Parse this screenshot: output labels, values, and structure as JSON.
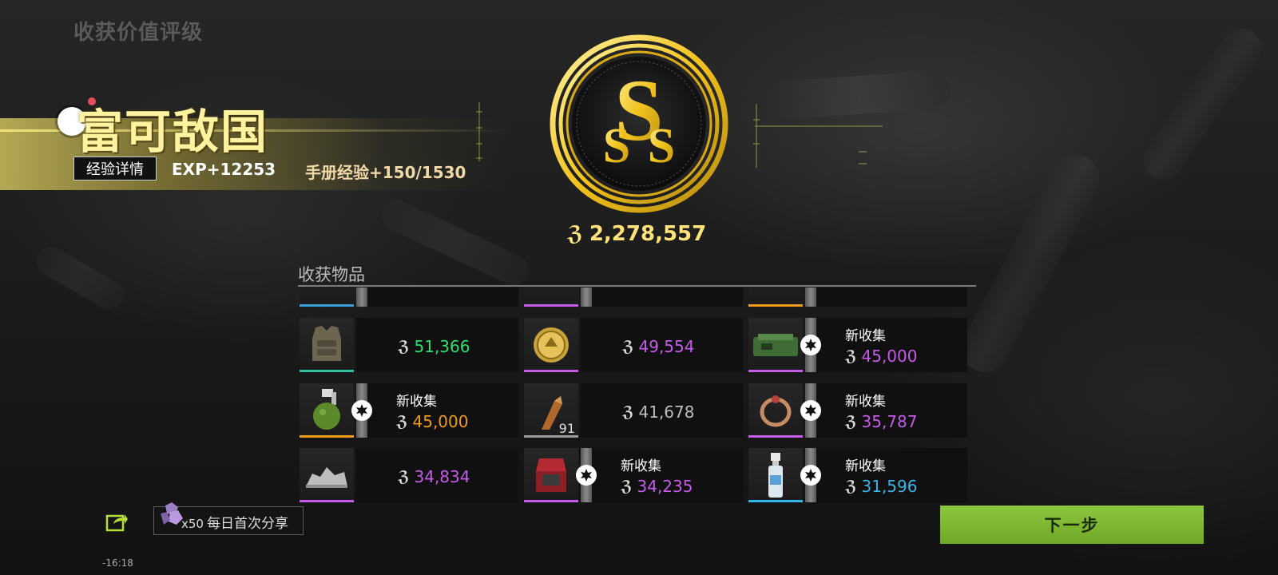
{
  "page": {
    "title": "收获价值评级"
  },
  "rank": {
    "title": "富可敌国",
    "exp_detail_label": "经验详情",
    "exp": "EXP+12253",
    "manual_exp": "手册经验+150/1530",
    "grade": "SSS",
    "total_value": "2,278,557",
    "total_value_color": "#ffe37a"
  },
  "items": {
    "header": "收获物品",
    "new_label_text": "新收集",
    "rows": [
      [
        {
          "name": "body-armor",
          "value": "51,366",
          "color": "#2ee06f",
          "rarity": "#2fbf9a",
          "new": false,
          "count": ""
        },
        {
          "name": "gold-coin",
          "value": "49,554",
          "color": "#c65bea",
          "rarity": "#c65bea",
          "new": false,
          "count": ""
        },
        {
          "name": "green-device",
          "value": "45,000",
          "color": "#c65bea",
          "rarity": "#c65bea",
          "new": true,
          "count": ""
        }
      ],
      [
        {
          "name": "grenade",
          "value": "45,000",
          "color": "#f09a19",
          "rarity": "#f09a19",
          "new": true,
          "count": ""
        },
        {
          "name": "bullet",
          "value": "41,678",
          "color": "#bdbdbd",
          "rarity": "#9a9a9a",
          "new": false,
          "count": "91"
        },
        {
          "name": "ring",
          "value": "35,787",
          "color": "#c65bea",
          "rarity": "#c65bea",
          "new": true,
          "count": ""
        }
      ],
      [
        {
          "name": "silver-figurine",
          "value": "34,834",
          "color": "#c65bea",
          "rarity": "#c65bea",
          "new": false,
          "count": ""
        },
        {
          "name": "jewelry-box",
          "value": "34,235",
          "color": "#c65bea",
          "rarity": "#c65bea",
          "new": true,
          "count": ""
        },
        {
          "name": "spray-bottle",
          "value": "31,596",
          "color": "#39b4e8",
          "rarity": "#39b4e8",
          "new": true,
          "count": ""
        }
      ]
    ],
    "top_partial_rarities": [
      "#3aa1d8",
      "#c65bea",
      "#f09a19"
    ]
  },
  "share": {
    "multiplier": "x50",
    "label": "每日首次分享"
  },
  "next_button": {
    "label": "下一步"
  },
  "status": {
    "time": "-16:18"
  },
  "colors": {
    "accent_gold": "#ffe37a",
    "next_green": "#7fb832"
  }
}
